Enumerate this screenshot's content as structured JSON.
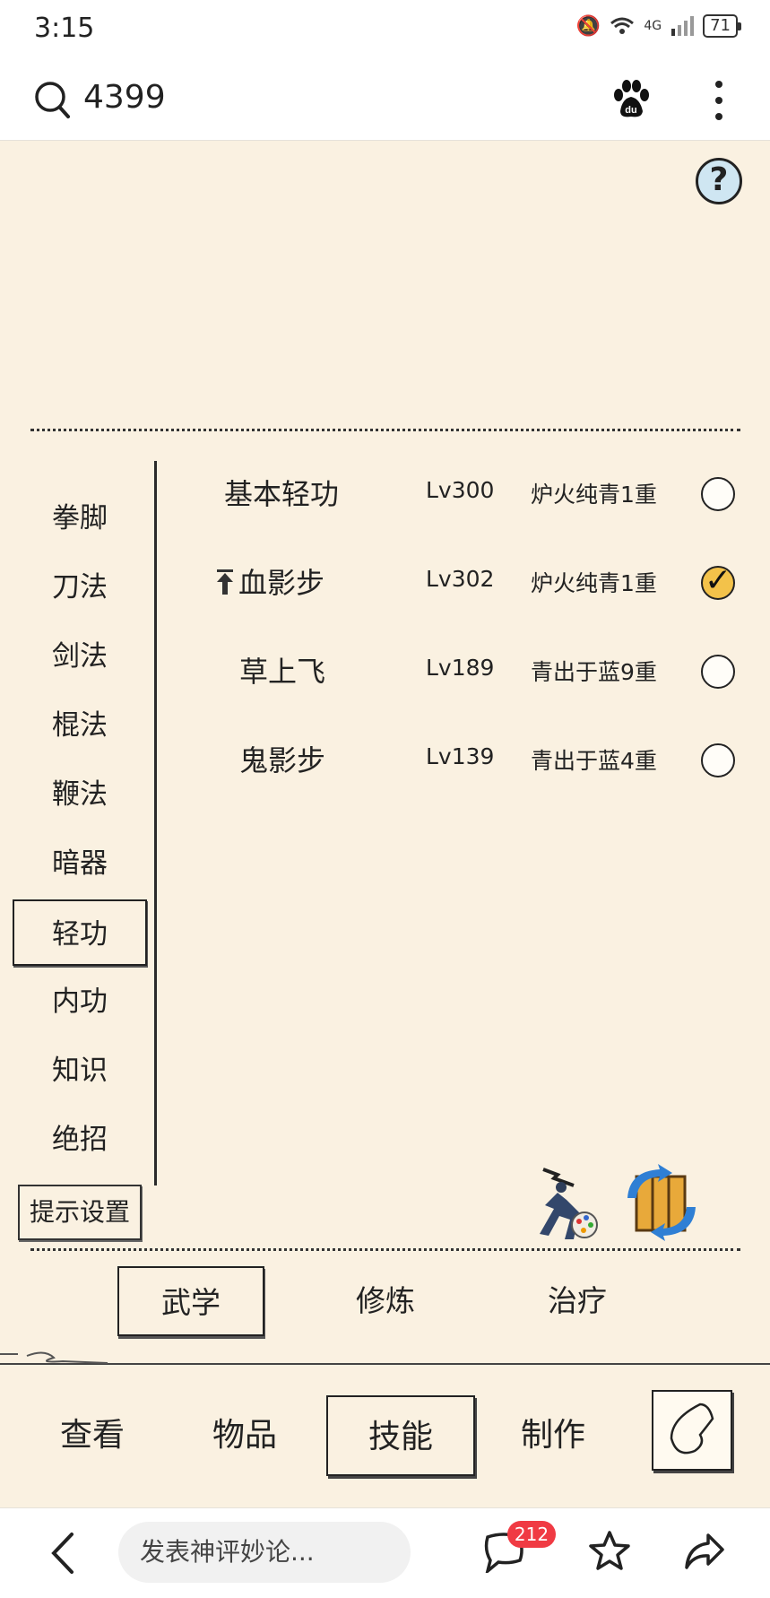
{
  "status_bar": {
    "time": "3:15",
    "network": "4G",
    "battery": "71"
  },
  "search": {
    "query": "4399"
  },
  "side_menu": [
    "拳脚",
    "刀法",
    "剑法",
    "棍法",
    "鞭法",
    "暗器",
    "轻功",
    "内功",
    "知识",
    "绝招"
  ],
  "side_menu_active": "轻功",
  "hint_settings_label": "提示设置",
  "skills": [
    {
      "name": "基本轻功",
      "level": "Lv300",
      "tier": "炉火纯青1重",
      "selected": false,
      "upgrade_arrow": false
    },
    {
      "name": "血影步",
      "level": "Lv302",
      "tier": "炉火纯青1重",
      "selected": true,
      "upgrade_arrow": true
    },
    {
      "name": "草上飞",
      "level": "Lv189",
      "tier": "青出于蓝9重",
      "selected": false,
      "upgrade_arrow": false
    },
    {
      "name": "鬼影步",
      "level": "Lv139",
      "tier": "青出于蓝4重",
      "selected": false,
      "upgrade_arrow": false
    }
  ],
  "category_tabs": [
    "武学",
    "修炼",
    "治疗"
  ],
  "category_active": "武学",
  "bottom_nav": [
    "查看",
    "物品",
    "技能",
    "制作"
  ],
  "bottom_nav_active": "技能",
  "browser_bar": {
    "comment_placeholder": "发表神评妙论...",
    "comment_count": "212"
  },
  "icons": {
    "help": "question-icon",
    "martial-artist": "martial-artist-icon",
    "swap": "swap-scroll-icon",
    "back": "back-icon"
  }
}
